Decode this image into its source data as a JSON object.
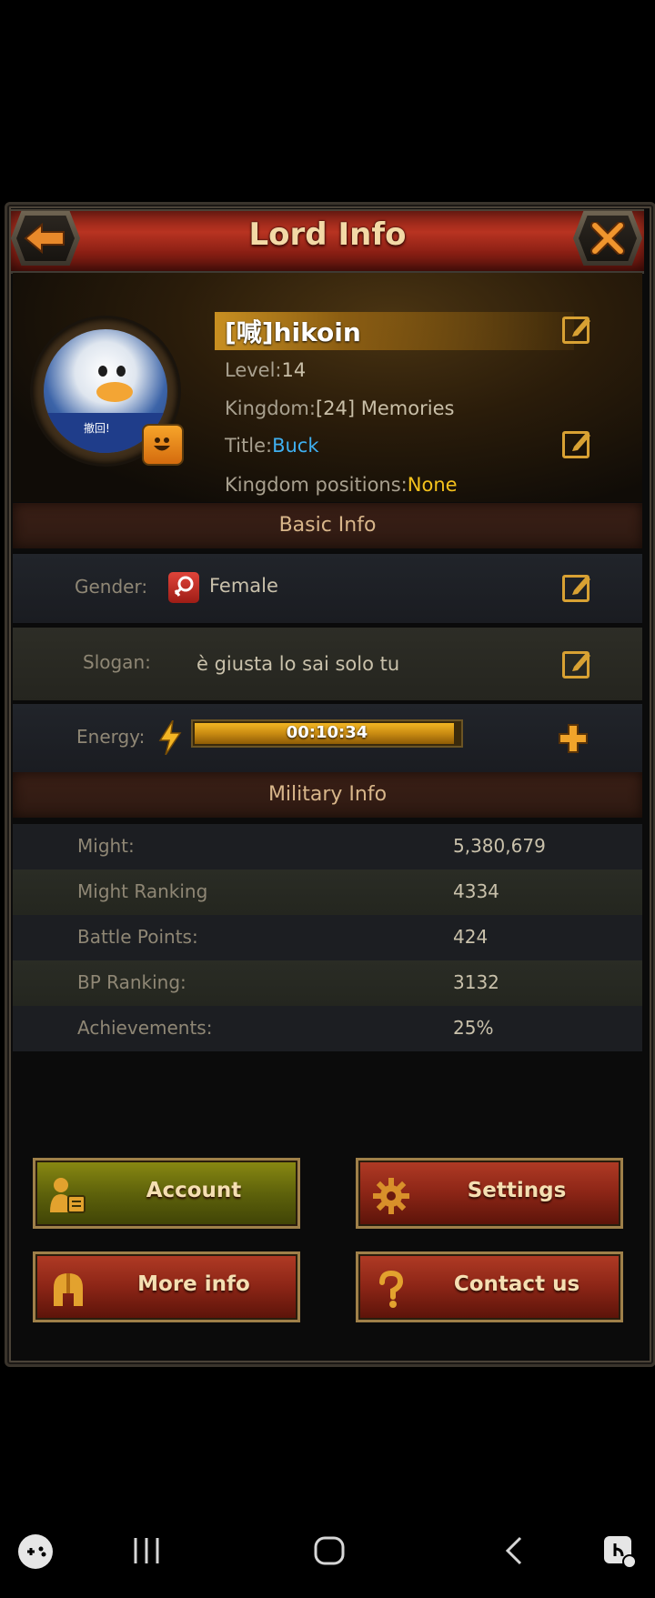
{
  "header": {
    "title": "Lord Info"
  },
  "profile": {
    "name": "[喊]hikoin",
    "level_label": "Level:",
    "level_value": "14",
    "kingdom_label": "Kingdom:",
    "kingdom_value": "[24] Memories",
    "title_label": "Title:",
    "title_value": "Buck",
    "positions_label": "Kingdom positions:",
    "positions_value": "None",
    "avatar_shirt_text": "撤回!"
  },
  "basic_info": {
    "section_title": "Basic Info",
    "gender_label": "Gender:",
    "gender_value": "Female",
    "slogan_label": "Slogan:",
    "slogan_value": "è giusta lo sai solo tu",
    "energy_label": "Energy:",
    "energy_timer": "00:10:34",
    "energy_fill": 0.98
  },
  "military_info": {
    "section_title": "Military Info",
    "rows": [
      {
        "label": "Might:",
        "value": "5,380,679"
      },
      {
        "label": "Might Ranking",
        "value": "4334"
      },
      {
        "label": "Battle Points:",
        "value": "424"
      },
      {
        "label": "BP Ranking:",
        "value": "3132"
      },
      {
        "label": "Achievements:",
        "value": "25%"
      }
    ]
  },
  "buttons": {
    "account": "Account",
    "settings": "Settings",
    "more_info": "More info",
    "contact_us": "Contact us"
  },
  "colors": {
    "title_value": "#3fb0f0",
    "positions_value": "#f5c21c",
    "accent_gold": "#d8a133"
  },
  "icons": {
    "back": "arrow-left-icon",
    "close": "close-x-icon",
    "edit": "edit-pencil-icon",
    "gender": "female-symbol-icon",
    "energy": "lightning-icon",
    "add": "plus-icon",
    "account": "user-card-icon",
    "settings": "gear-icon",
    "more_info": "helmet-icon",
    "contact": "question-mark-icon"
  }
}
